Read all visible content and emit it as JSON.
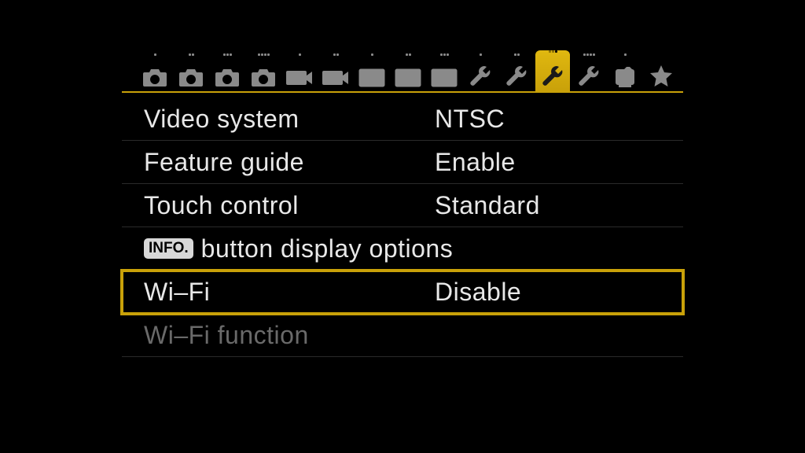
{
  "tabs": {
    "selectedIndex": 11,
    "items": [
      {
        "type": "camera",
        "dots": 1
      },
      {
        "type": "camera",
        "dots": 2
      },
      {
        "type": "camera",
        "dots": 3
      },
      {
        "type": "camera",
        "dots": 4
      },
      {
        "type": "movie",
        "dots": 1
      },
      {
        "type": "movie",
        "dots": 2
      },
      {
        "type": "play",
        "dots": 1
      },
      {
        "type": "play",
        "dots": 2
      },
      {
        "type": "play",
        "dots": 3
      },
      {
        "type": "wrench",
        "dots": 1
      },
      {
        "type": "wrench",
        "dots": 2
      },
      {
        "type": "wrench",
        "dots": 3
      },
      {
        "type": "wrench",
        "dots": 4
      },
      {
        "type": "custom",
        "dots": 1
      },
      {
        "type": "star",
        "dots": 0
      }
    ]
  },
  "menu": {
    "items": [
      {
        "label": "Video system",
        "value": "NTSC"
      },
      {
        "label": "Feature guide",
        "value": "Enable"
      },
      {
        "label": "Touch control",
        "value": "Standard"
      },
      {
        "badge": "INFO.",
        "label": "button display options",
        "value": "",
        "fullRow": true
      },
      {
        "label": "Wi–Fi",
        "value": "Disable",
        "selected": true
      },
      {
        "label": "Wi–Fi function",
        "value": "",
        "disabled": true
      }
    ]
  }
}
